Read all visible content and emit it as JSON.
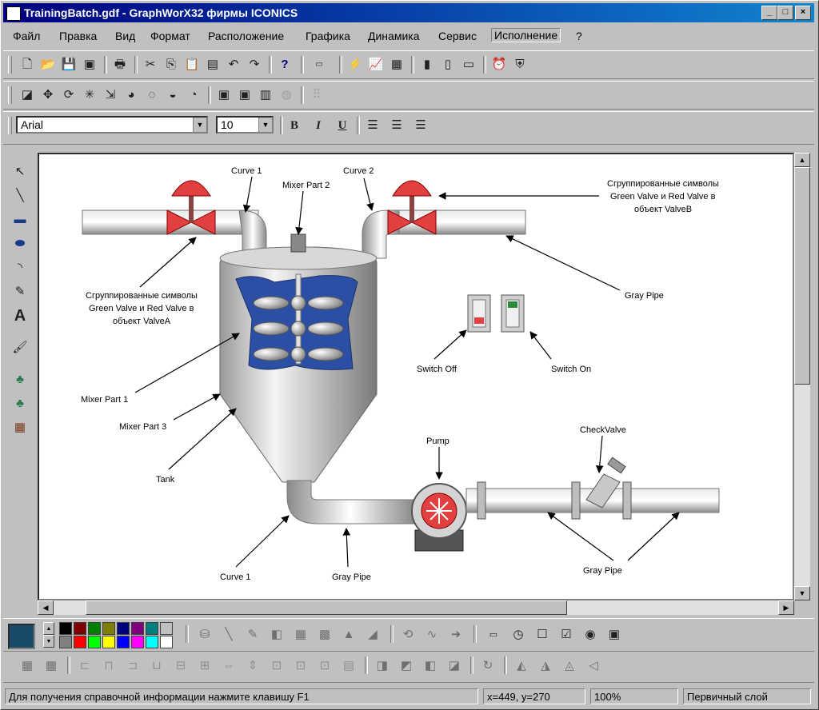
{
  "window": {
    "title": "TrainingBatch.gdf - GraphWorX32 фирмы ICONICS",
    "controls": [
      "_",
      "□",
      "×"
    ]
  },
  "menu": {
    "items": [
      "Файл",
      "Правка",
      "Вид",
      "Формат",
      "Расположение",
      "Графика",
      "Динамика",
      "Сервис",
      "Исполнение",
      "?"
    ],
    "active": "Исполнение"
  },
  "format_bar": {
    "font": "Arial",
    "size": "10",
    "bold": "B",
    "italic": "I",
    "underline": "U"
  },
  "left_tools": {
    "text_tool": "A"
  },
  "diagram": {
    "labels": {
      "curve1_top": "Curve 1",
      "curve2_top": "Curve 2",
      "mixer_part2": "Mixer Part 2",
      "grouped_b_1": "Сгруппированные символы",
      "grouped_b_2": "Green Valve и Red Valve в",
      "grouped_b_3": "объект ValveB",
      "grouped_a_1": "Сгруппированные символы",
      "grouped_a_2": "Green Valve и Red Valve в",
      "grouped_a_3": "объект ValveA",
      "gray_pipe_top": "Gray Pipe",
      "switch_off": "Switch Off",
      "switch_on": "Switch On",
      "mixer_part1": "Mixer Part 1",
      "mixer_part3": "Mixer Part 3",
      "tank": "Tank",
      "pump": "Pump",
      "check_valve": "CheckValve",
      "curve1_bottom": "Curve 1",
      "gray_pipe_bottom": "Gray Pipe",
      "gray_pipe_right": "Gray Pipe"
    },
    "colors": {
      "pipe": "#b8b8b8",
      "valve_red": "#e04040",
      "mixer_blue": "#2c4fa6"
    }
  },
  "palette": {
    "colors": [
      "#000000",
      "#7f0000",
      "#007f00",
      "#7f7f00",
      "#00007f",
      "#7f007f",
      "#007f7f",
      "#c0c0c0",
      "#808080",
      "#ff0000",
      "#00ff00",
      "#ffff00",
      "#0000ff",
      "#ff00ff",
      "#00ffff",
      "#ffffff"
    ]
  },
  "status": {
    "help": "Для получения справочной информации нажмите клавишу F1",
    "coords": "x=449, y=270",
    "zoom": "100%",
    "layer": "Первичный слой"
  }
}
